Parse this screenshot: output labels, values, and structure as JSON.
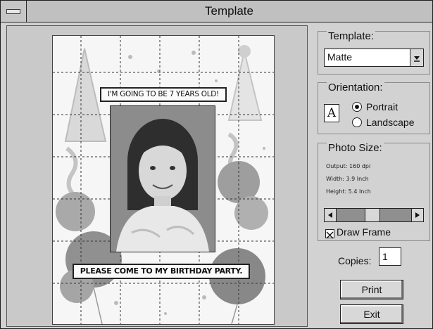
{
  "window": {
    "title": "Template"
  },
  "preview": {
    "banner_top": "I'M GOING TO BE 7 YEARS OLD!",
    "banner_bottom": "PLEASE COME TO MY BIRTHDAY PARTY."
  },
  "template_group": {
    "title": "Template:",
    "selected": "Matte",
    "options": [
      "Matte"
    ]
  },
  "orientation_group": {
    "title": "Orientation:",
    "icon_letter": "A",
    "options": [
      {
        "label": "Portrait",
        "checked": true
      },
      {
        "label": "Landscape",
        "checked": false
      }
    ]
  },
  "photo_size_group": {
    "title": "Photo Size:",
    "output": "Output: 160 dpi",
    "width": "Width: 3.9 Inch",
    "height": "Height: 5.4 Inch",
    "slider_fraction": 0.47,
    "draw_frame_label": "Draw Frame",
    "draw_frame_checked": true
  },
  "copies": {
    "label": "Copies:",
    "value": "1"
  },
  "buttons": {
    "print": "Print",
    "exit": "Exit"
  },
  "colors": {
    "window_bg": "#d2d2d2",
    "titlebar_bg": "#c0c0c0",
    "photo_bg": "#8a8a8a"
  }
}
